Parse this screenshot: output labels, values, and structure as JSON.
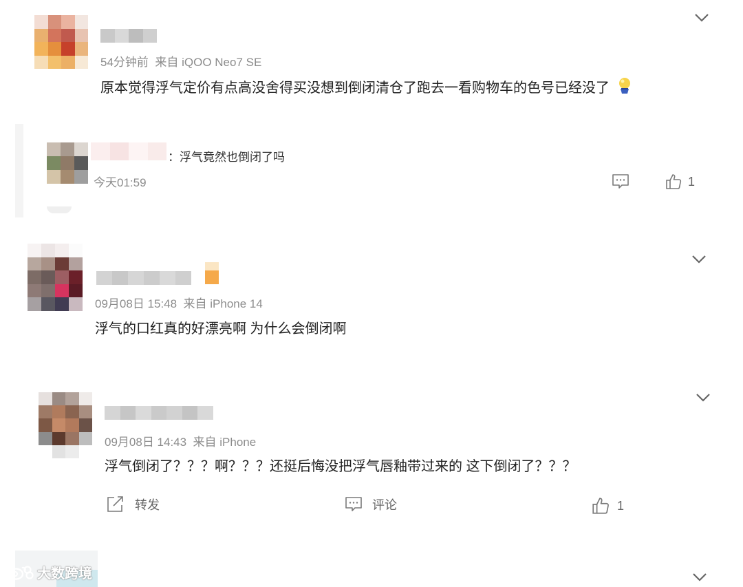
{
  "comments": [
    {
      "time": "54分钟前",
      "source": "来自 iQOO Neo7 SE",
      "text": "原本觉得浮气定价有点高没舍得买没想到倒闭清仓了跑去一看购物车的色号已经没了",
      "emoji_icon": "crystal-ball-emoji-icon"
    },
    {
      "time": "09月08日 15:48",
      "source": "来自 iPhone 14",
      "text": "浮气的口红真的好漂亮啊 为什么会倒闭啊"
    },
    {
      "time": "09月08日 14:43",
      "source": "来自 iPhone",
      "text": "浮气倒闭了？？？啊？？？还挺后悔没把浮气唇釉带过来的 这下倒闭了？？？",
      "actions": {
        "repost_label": "转发",
        "comment_label": "评论",
        "like_count": "1"
      }
    }
  ],
  "reply": {
    "text": "：浮气竟然也倒闭了吗",
    "time": "今天01:59",
    "like_count": "1"
  },
  "watermark": {
    "text": "大数跨境",
    "icon": "weibo-logo-icon"
  },
  "colors": {
    "text": "#222222",
    "meta": "#8c8c8c",
    "icon": "#7a7a7a",
    "chevron": "#666666"
  }
}
